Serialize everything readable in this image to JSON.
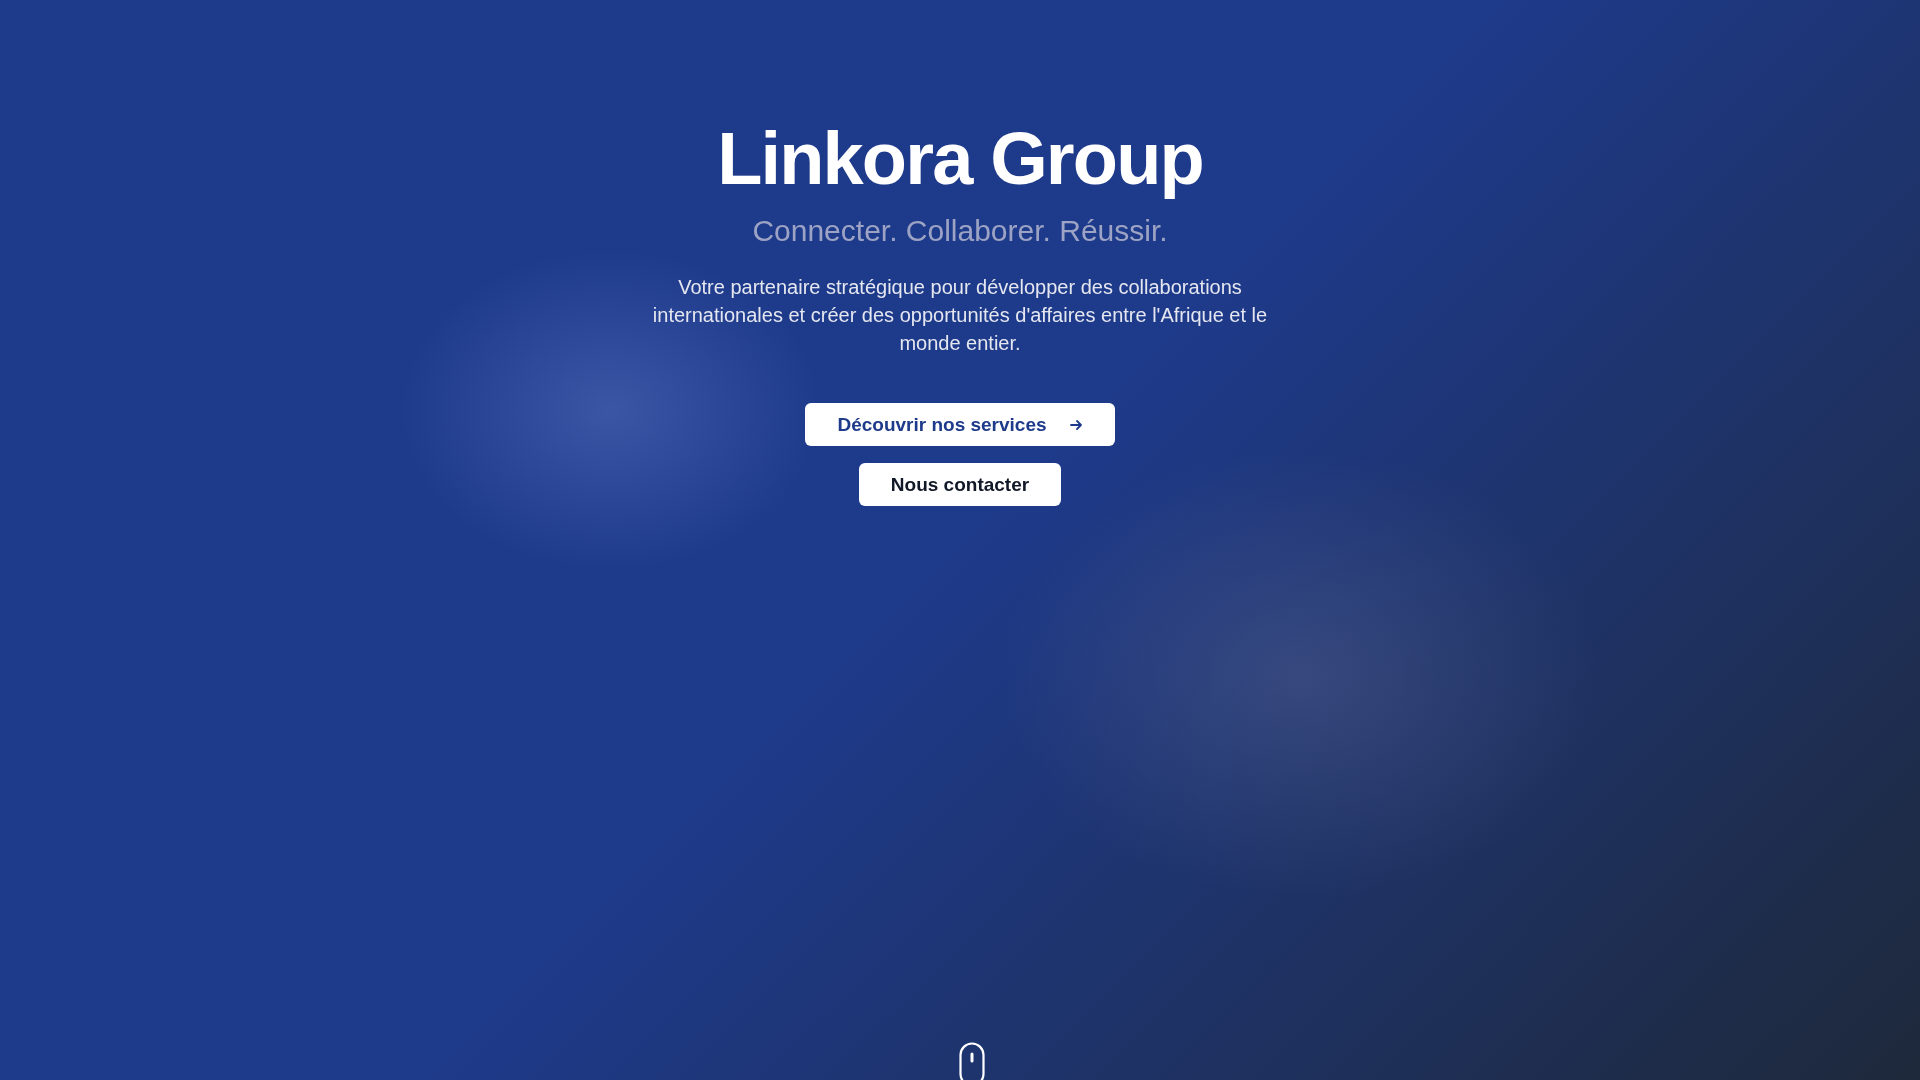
{
  "hero": {
    "title": "Linkora Group",
    "tagline": "Connecter. Collaborer. Réussir.",
    "description": "Votre partenaire stratégique pour développer des collaborations internationales et créer des opportunités d'affaires entre l'Afrique et le monde entier."
  },
  "buttons": [
    {
      "label": "Découvrir nos services",
      "kind": "primary"
    },
    {
      "label": "Nous contacter",
      "kind": "secondary"
    }
  ]
}
